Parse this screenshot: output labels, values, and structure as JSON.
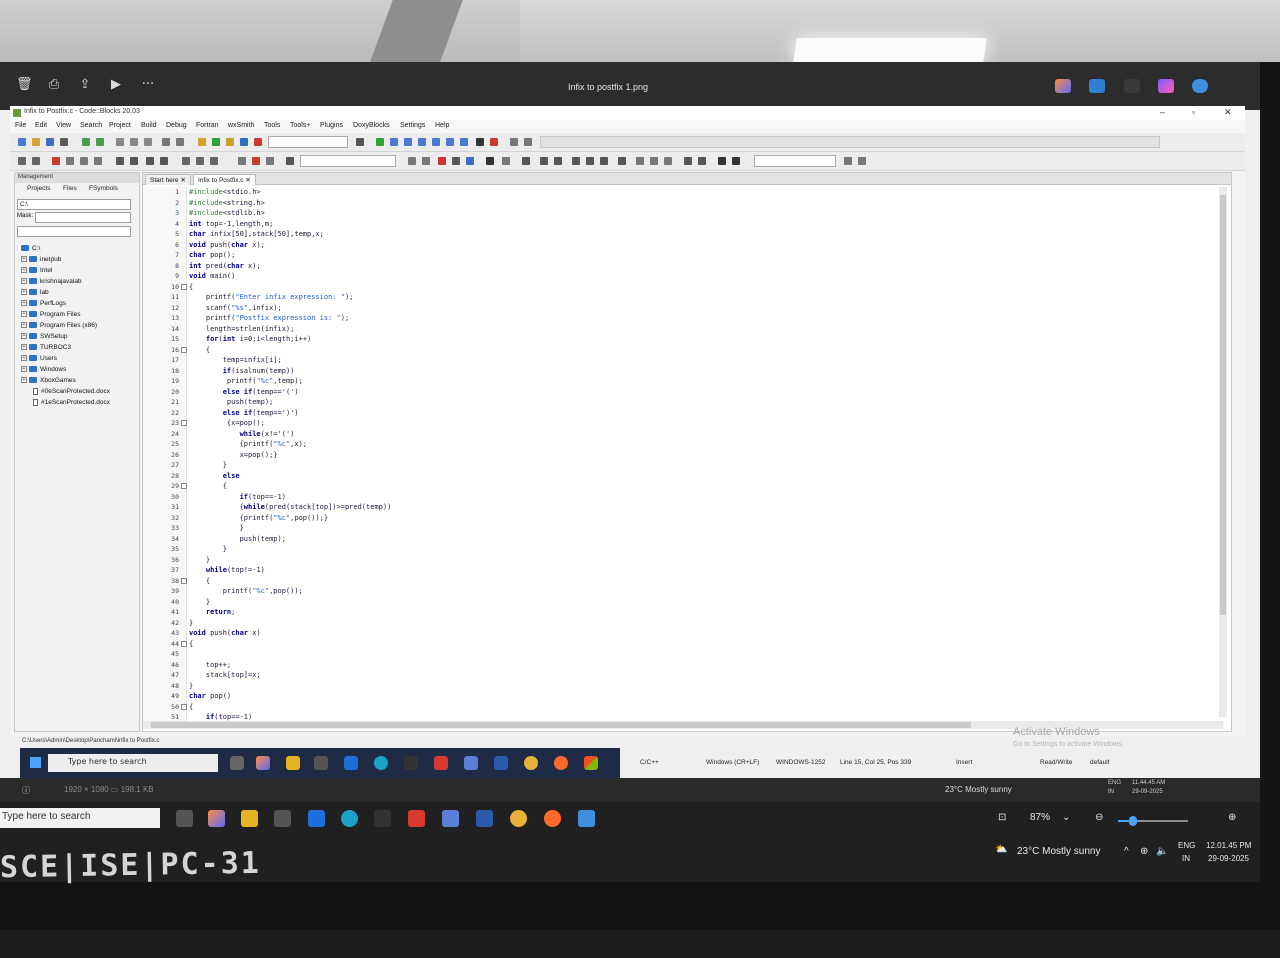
{
  "viewer": {
    "title": "Infix to postfix 1.png",
    "left_icons": [
      "trash-icon",
      "print-icon",
      "share-icon",
      "slideshow-icon",
      "more-icon"
    ],
    "more_glyph": "···",
    "bottom_meta": "1920 × 1080   ▭   198.1 KB",
    "zoom": "87%",
    "zoom_fraction": 0.22
  },
  "codeblocks": {
    "window_title": "Infix to Postfix.c - Code::Blocks 20.03",
    "menu": [
      "File",
      "Edit",
      "View",
      "Search",
      "Project",
      "Build",
      "Debug",
      "Fortran",
      "wxSmith",
      "Tools",
      "Tools+",
      "Plugins",
      "DoxyBlocks",
      "Settings",
      "Help"
    ],
    "management": {
      "title": "Management",
      "tabs": [
        "Projects",
        "Files",
        "FSymbols"
      ],
      "path_value": "C:\\",
      "mask_label": "Mask:",
      "tree_root": "C:\\",
      "tree": [
        "inetpub",
        "Intel",
        "krishnajavalab",
        "lab",
        "PerfLogs",
        "Program Files",
        "Program Files (x86)",
        "SWSetup",
        "TURBOC3",
        "Users",
        "Windows",
        "XboxGames"
      ],
      "files": [
        "#0eScanProtected.docx",
        "#1eScanProtected.docx"
      ]
    },
    "tabs": [
      "Start here",
      "Infix to Postfix.c"
    ],
    "code": [
      "#include<stdio.h>",
      "#include<string.h>",
      "#include<stdlib.h>",
      "int top=-1,length,m;",
      "char infix[50],stack[50],temp,x;",
      "void push(char x);",
      "char pop();",
      "int pred(char x);",
      "void main()",
      "{",
      "    printf(\"Enter infix expression: \");",
      "    scanf(\"%s\",infix);",
      "    printf(\"Postfix expression is: \");",
      "    length=strlen(infix);",
      "    for(int i=0;i<length;i++)",
      "    {",
      "        temp=infix[i];",
      "        if(isalnum(temp))",
      "         printf(\"%c\",temp);",
      "        else if(temp=='(')",
      "         push(temp);",
      "        else if(temp==')')",
      "         {x=pop();",
      "            while(x!='(')",
      "            {printf(\"%c\",x);",
      "            x=pop();}",
      "        }",
      "        else",
      "        {",
      "            if(top==-1)",
      "            {while(pred(stack[top])>=pred(temp))",
      "            {printf(\"%c\",pop());}",
      "            }",
      "            push(temp);",
      "        }",
      "    }",
      "    while(top!=-1)",
      "    {",
      "        printf(\"%c\",pop());",
      "    }",
      "    return;",
      "}",
      "void push(char x)",
      "{",
      "",
      "    top++;",
      "    stack[top]=x;",
      "}",
      "char pop()",
      "{",
      "    if(top==-1)"
    ],
    "fold_lines": [
      10,
      16,
      23,
      29,
      38,
      44,
      50
    ],
    "file_path": "C:\\Users\\Admin\\Desktop\\Panchami\\infix to Postfix.c",
    "status": {
      "lang": "C/C++",
      "eol": "Windows (CR+LF)",
      "encoding": "WINDOWS-1252",
      "position": "Line 15, Col 25, Pos 339",
      "mode": "Insert",
      "access": "Read/Write",
      "profile": "default"
    },
    "watermark_title": "Activate Windows",
    "watermark_sub": "Go to Settings to activate Windows.",
    "inner_search": "Type here to search",
    "inner_weather": "23°C  Mostly sunny",
    "inner_lang": "ENG",
    "inner_region": "IN",
    "inner_time": "11.44.45 AM",
    "inner_date": "29-09-2025"
  },
  "taskbar": {
    "search_placeholder": "Type here to search",
    "weather": "23°C  Mostly sunny",
    "lang": "ENG",
    "region": "IN",
    "time": "12.01.45 PM",
    "date": "29-09-2025"
  },
  "sticker_text": "SCE|ISE|PC-31",
  "colors": {
    "accent": "#4aa3ff",
    "folder": "#2f73c9",
    "code_keyword": "#00008b",
    "code_string": "#1e5bd8",
    "code_number": "#e0301e"
  }
}
